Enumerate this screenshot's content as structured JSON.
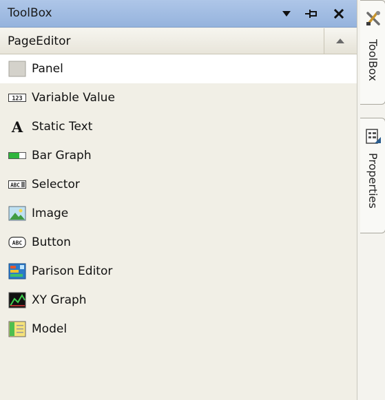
{
  "toolbox": {
    "title": "ToolBox",
    "buttons": {
      "dropdown_icon": "triangle-down-icon",
      "pin_icon": "pushpin-icon",
      "close_icon": "close-icon"
    },
    "group": {
      "label": "PageEditor",
      "collapse_icon": "triangle-up-icon"
    },
    "items": [
      {
        "label": "Panel",
        "icon": "panel-icon",
        "selected": true
      },
      {
        "label": "Variable Value",
        "icon": "numeric-123-icon",
        "icon_text": "123"
      },
      {
        "label": "Static Text",
        "icon": "letter-a-icon",
        "icon_text": "A"
      },
      {
        "label": "Bar Graph",
        "icon": "bar-graph-icon"
      },
      {
        "label": "Selector",
        "icon": "selector-icon",
        "icon_text": "ABC"
      },
      {
        "label": "Image",
        "icon": "image-icon"
      },
      {
        "label": "Button",
        "icon": "button-abc-icon",
        "icon_text": "ABC"
      },
      {
        "label": "Parison Editor",
        "icon": "parison-editor-icon"
      },
      {
        "label": "XY Graph",
        "icon": "xy-graph-icon"
      },
      {
        "label": "Model",
        "icon": "model-icon"
      }
    ]
  },
  "side_tabs": [
    {
      "label": "ToolBox",
      "icon": "tools-icon"
    },
    {
      "label": "Properties",
      "icon": "properties-icon"
    }
  ],
  "colors": {
    "titlebar": "#9fbce3",
    "panel_background": "#f1efe6",
    "selected_item": "#ffffff"
  }
}
